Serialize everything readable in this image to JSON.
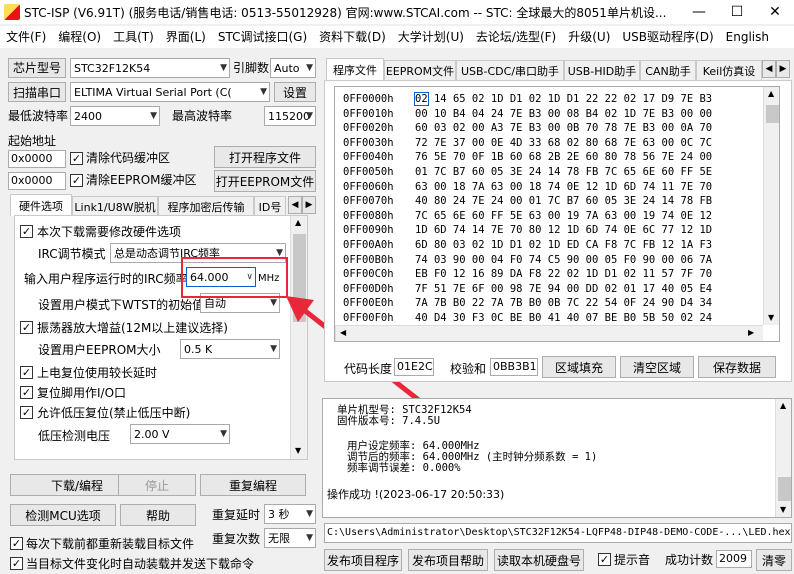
{
  "window": {
    "title": "STC-ISP (V6.91T) (服务电话/销售电话: 0513-55012928) 官网:www.STCAI.com  -- STC: 全球最大的8051单片机设...",
    "minimize_glyph": "—",
    "maximize_glyph": "☐",
    "close_glyph": "✕"
  },
  "menu": [
    "文件(F)",
    "编程(O)",
    "工具(T)",
    "界面(L)",
    "STC调试接口(G)",
    "资料下载(D)",
    "大学计划(U)",
    "去论坛/选型(F)",
    "升级(U)",
    "USB驱动程序(D)",
    "English"
  ],
  "left": {
    "chip_label": "芯片型号",
    "chip_value": "STC32F12K54",
    "pin_label": "引脚数",
    "pin_value": "Auto",
    "scan_label": "扫描串口",
    "port_value": "ELTIMA Virtual Serial Port (C(",
    "settings_label": "设置",
    "min_baud_label": "最低波特率",
    "min_baud_value": "2400",
    "max_baud_label": "最高波特率",
    "max_baud_value": "115200",
    "start_addr_label": "起始地址",
    "addr1": "0x0000",
    "clear_code_label": "清除代码缓冲区",
    "open_program_label": "打开程序文件",
    "addr2": "0x0000",
    "clear_eeprom_label": "清除EEPROM缓冲区",
    "open_eeprom_label": "打开EEPROM文件",
    "tabs": [
      "硬件选项",
      "Link1/U8W脱机",
      "程序加密后传输",
      "ID号"
    ],
    "hw": {
      "reload_label": "本次下载需要修改硬件选项",
      "irc_mode_label": "IRC调节模式",
      "irc_mode_value": "总是动态调节IRC频率",
      "freq_label": "输入用户程序运行时的IRC频率",
      "freq_value": "64.000",
      "freq_unit": "MHz",
      "wtst_label": "设置用户模式下WTST的初始值",
      "wtst_value": "自动",
      "osc_label": "振荡器放大增益(12M以上建议选择)",
      "eeprom_size_label": "设置用户EEPROM大小",
      "eeprom_size_value": "0.5 K",
      "por_label": "上电复位使用较长延时",
      "reset_pin_label": "复位脚用作I/O口",
      "lvr_label": "允许低压复位(禁止低压中断)",
      "lvd_label": "低压检测电压",
      "lvd_value": "2.00 V"
    },
    "download_label": "下载/编程",
    "stop_label": "停止",
    "reprogram_label": "重复编程",
    "detect_label": "检测MCU选项",
    "help_label": "帮助",
    "delay_label": "重复延时",
    "delay_value": "3 秒",
    "repeat_count_label": "重复次数",
    "repeat_count_value": "无限",
    "reload_before_label": "每次下载前都重新装载目标文件",
    "auto_load_label": "当目标文件变化时自动装载并发送下载命令"
  },
  "right": {
    "tabs": [
      "程序文件",
      "EEPROM文件",
      "USB-CDC/串口助手",
      "USB-HID助手",
      "CAN助手",
      "Keil仿真设"
    ],
    "hex": [
      {
        "addr": "0FF0000h",
        "bytes": "02 14 65 02 1D D1 02 1D D1 22 22 02 17 D9 7E B3"
      },
      {
        "addr": "0FF0010h",
        "bytes": "00 10 B4 04 24 7E B3 00 08 B4 02 1D 7E B3 00 00"
      },
      {
        "addr": "0FF0020h",
        "bytes": "60 03 02 00 A3 7E B3 00 0B 70 78 7E B3 00 0A 70"
      },
      {
        "addr": "0FF0030h",
        "bytes": "72 7E 37 00 0E 4D 33 68 02 80 68 7E 63 00 0C 7C"
      },
      {
        "addr": "0FF0040h",
        "bytes": "76 5E 70 0F 1B 60 68 2B 2E 60 80 78 56 7E 24 00"
      },
      {
        "addr": "0FF0050h",
        "bytes": "01 7C B7 60 05 3E 24 14 78 FB 7C 65 6E 60 FF 5E"
      },
      {
        "addr": "0FF0060h",
        "bytes": "63 00 18 7A 63 00 18 74 0E 12 1D 6D 74 11 7E 70"
      },
      {
        "addr": "0FF0070h",
        "bytes": "40 80 24 7E 24 00 01 7C B7 60 05 3E 24 14 78 FB"
      },
      {
        "addr": "0FF0080h",
        "bytes": "7C 65 6E 60 FF 5E 63 00 19 7A 63 00 19 74 0E 12"
      },
      {
        "addr": "0FF0090h",
        "bytes": "1D 6D 74 14 7E 70 80 12 1D 6D 74 0E 6C 77 12 1D"
      },
      {
        "addr": "0FF00A0h",
        "bytes": "6D 80 03 02 1D D1 02 1D ED CA F8 7C FB 12 1A F3"
      },
      {
        "addr": "0FF00B0h",
        "bytes": "74 03 90 00 04 F0 74 C5 90 00 05 F0 90 00 06 7A"
      },
      {
        "addr": "0FF00C0h",
        "bytes": "EB F0 12 16 89 DA F8 22 02 1D D1 02 11 57 7F 70"
      },
      {
        "addr": "0FF00D0h",
        "bytes": "7F 51 7E 6F 00 98 7E 94 00 DD 02 01 17 40 05 E4"
      },
      {
        "addr": "0FF00E0h",
        "bytes": "7A 7B B0 22 7A 7B B0 0B 7C 22 54 0F 24 90 D4 34"
      },
      {
        "addr": "0FF00F0h",
        "bytes": "40 D4 30 F3 0C BE B0 41 40 07 BE B0 5B 50 02 24"
      }
    ],
    "code_len_label": "代码长度",
    "code_len_value": "01E2C",
    "checksum_label": "校验和",
    "checksum_value": "0BB3B1",
    "fill_label": "区域填充",
    "clear_label": "清空区域",
    "save_label": "保存数据",
    "info": [
      "单片机型号: STC32F12K54",
      "固件版本号: 7.4.5U",
      "",
      "用户设定频率: 64.000MHz",
      "调节后的频率: 64.000MHz (主时钟分频系数 = 1)",
      "频率调节误差: 0.000%",
      "",
      "",
      "操作成功 !(2023-06-17 20:50:33)"
    ],
    "hex_path": "C:\\Users\\Administrator\\Desktop\\STC32F12K54-LQFP48-DIP48-DEMO-CODE-...\\LED.hex",
    "publish_label": "发布项目程序",
    "publish_help_label": "发布项目帮助",
    "read_serial_label": "读取本机硬盘号",
    "beep_label": "提示音",
    "success_count_label": "成功计数",
    "success_count_value": "2009",
    "clear_count_label": "清零"
  },
  "colors": {
    "annotation_red": "#e8283a",
    "focus_blue": "#0b5cd6"
  }
}
